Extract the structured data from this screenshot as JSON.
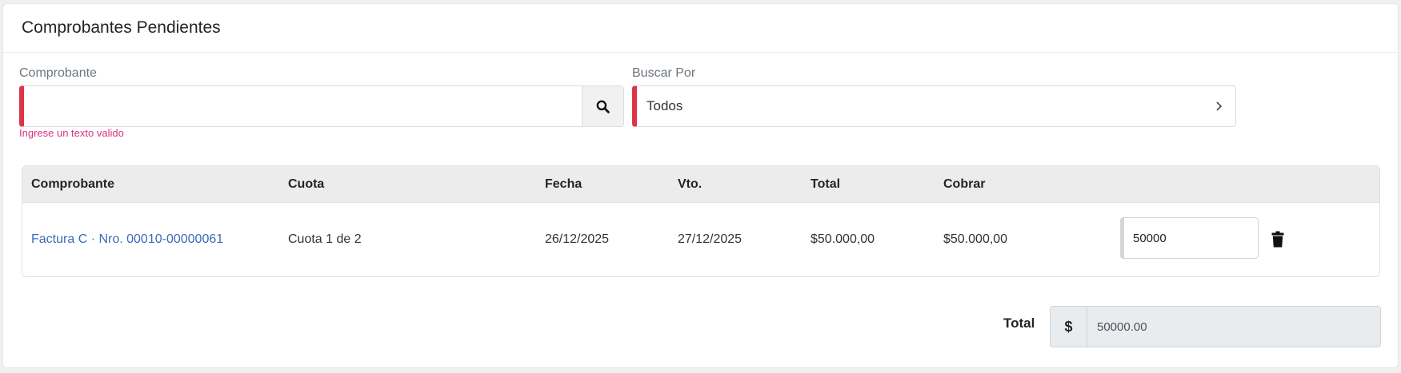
{
  "header": {
    "title": "Comprobantes Pendientes"
  },
  "filters": {
    "comprobante_label": "Comprobante",
    "comprobante_value": "",
    "comprobante_error": "Ingrese un texto valido",
    "buscar_label": "Buscar Por",
    "buscar_value": "Todos"
  },
  "table": {
    "headers": [
      "Comprobante",
      "Cuota",
      "Fecha",
      "Vto.",
      "Total",
      "Cobrar"
    ],
    "rows": [
      {
        "comprobante": "Factura C · Nro. 00010-00000061",
        "cuota": "Cuota 1 de 2",
        "fecha": "26/12/2025",
        "vto": "27/12/2025",
        "total": "$50.000,00",
        "cobrar": "$50.000,00",
        "cobrar_input": "50000"
      }
    ]
  },
  "footer": {
    "total_label": "Total",
    "currency": "$",
    "total_value": "50000.00"
  },
  "colors": {
    "error_border": "#dc3545",
    "error_text": "#d63384",
    "link": "#3b6bb8"
  },
  "icons": {
    "search": "search-icon",
    "chevron": "chevron-right-icon",
    "delete": "trash-icon"
  }
}
